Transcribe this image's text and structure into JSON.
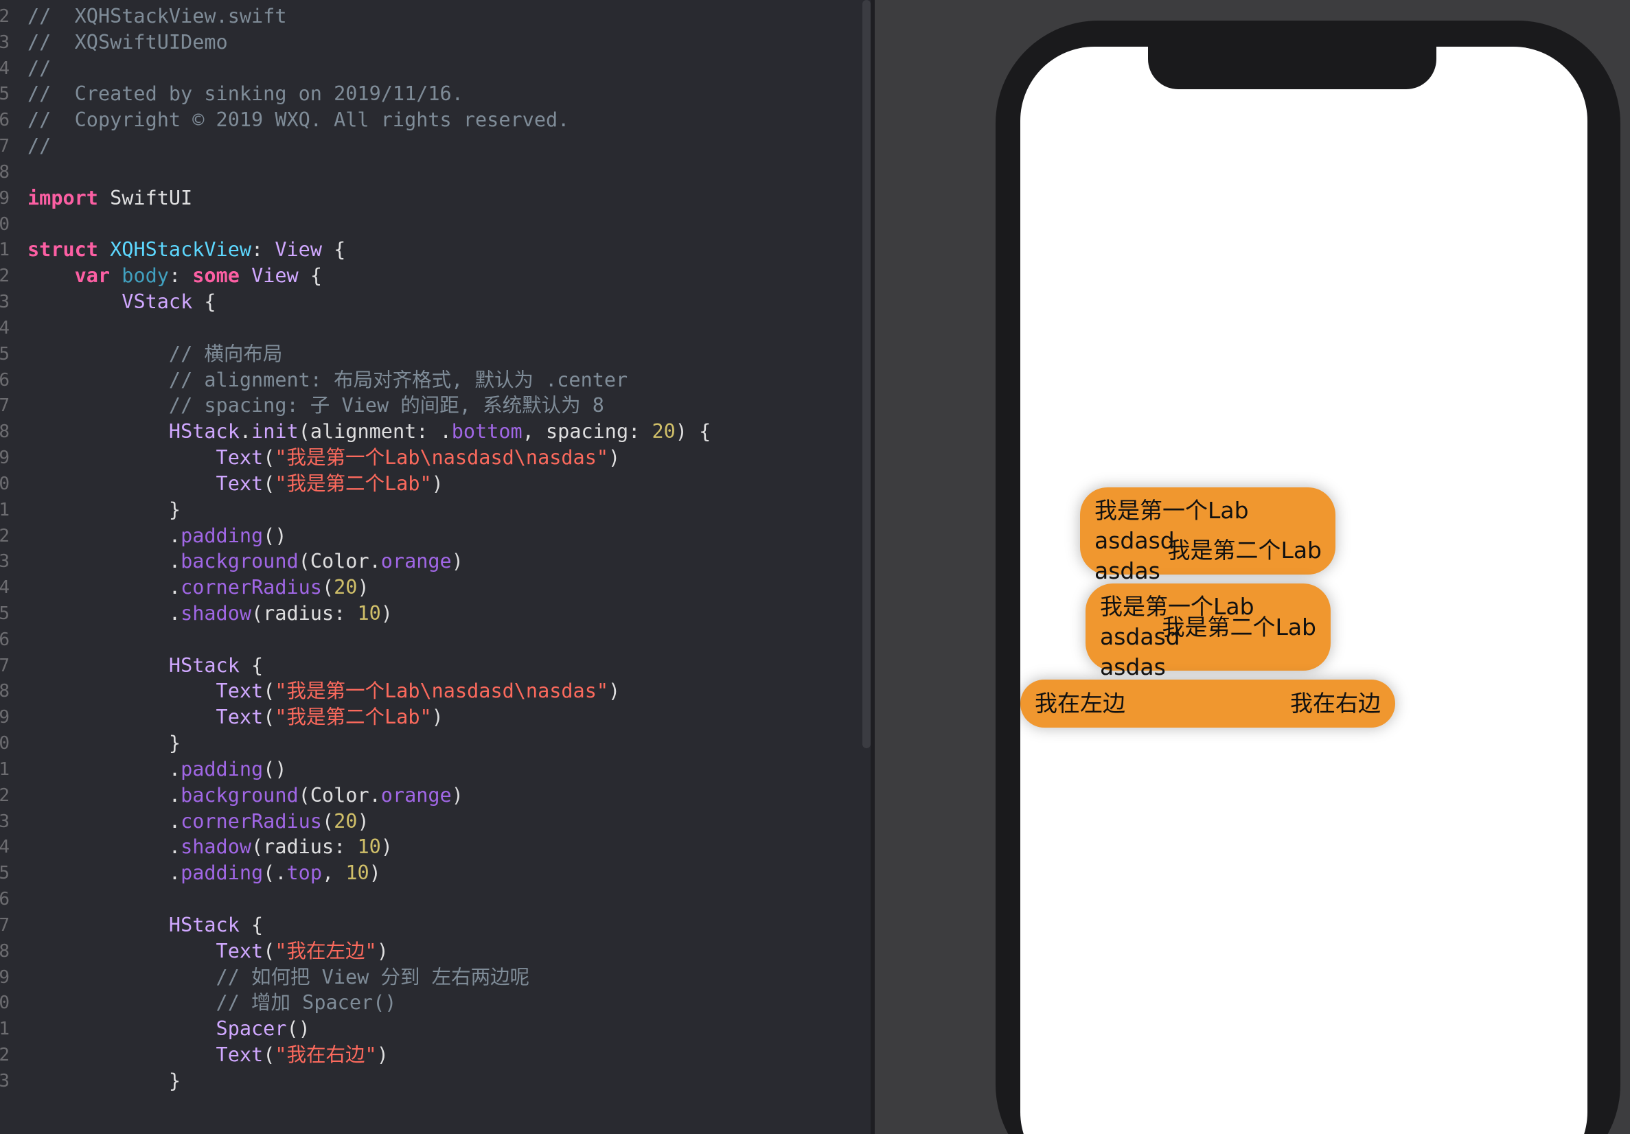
{
  "editor": {
    "lines": [
      {
        "n": "2",
        "segs": [
          {
            "c": "cm",
            "t": "//  XQHStackView.swift"
          }
        ]
      },
      {
        "n": "3",
        "segs": [
          {
            "c": "cm",
            "t": "//  XQSwiftUIDemo"
          }
        ]
      },
      {
        "n": "4",
        "segs": [
          {
            "c": "cm",
            "t": "//"
          }
        ]
      },
      {
        "n": "5",
        "segs": [
          {
            "c": "cm",
            "t": "//  Created by sinking on 2019/11/16."
          }
        ]
      },
      {
        "n": "6",
        "segs": [
          {
            "c": "cm",
            "t": "//  Copyright © 2019 WXQ. All rights reserved."
          }
        ]
      },
      {
        "n": "7",
        "segs": [
          {
            "c": "cm",
            "t": "//"
          }
        ]
      },
      {
        "n": "8",
        "segs": []
      },
      {
        "n": "9",
        "segs": [
          {
            "c": "kw",
            "t": "import"
          },
          {
            "c": "pl",
            "t": " SwiftUI"
          }
        ]
      },
      {
        "n": "0",
        "segs": []
      },
      {
        "n": "1",
        "segs": [
          {
            "c": "kw",
            "t": "struct"
          },
          {
            "c": "pl",
            "t": " "
          },
          {
            "c": "tn",
            "t": "XQHStackView"
          },
          {
            "c": "pl",
            "t": ": "
          },
          {
            "c": "ty",
            "t": "View"
          },
          {
            "c": "pl",
            "t": " {"
          }
        ]
      },
      {
        "n": "2",
        "segs": [
          {
            "c": "pl",
            "t": "    "
          },
          {
            "c": "kw",
            "t": "var"
          },
          {
            "c": "pl",
            "t": " "
          },
          {
            "c": "pv",
            "t": "body"
          },
          {
            "c": "pl",
            "t": ": "
          },
          {
            "c": "kw",
            "t": "some"
          },
          {
            "c": "pl",
            "t": " "
          },
          {
            "c": "ty",
            "t": "View"
          },
          {
            "c": "pl",
            "t": " {"
          }
        ]
      },
      {
        "n": "3",
        "segs": [
          {
            "c": "pl",
            "t": "        "
          },
          {
            "c": "ty",
            "t": "VStack"
          },
          {
            "c": "pl",
            "t": " {"
          }
        ]
      },
      {
        "n": "4",
        "segs": []
      },
      {
        "n": "5",
        "segs": [
          {
            "c": "pl",
            "t": "            "
          },
          {
            "c": "cm",
            "t": "// 横向布局"
          }
        ]
      },
      {
        "n": "6",
        "segs": [
          {
            "c": "pl",
            "t": "            "
          },
          {
            "c": "cm",
            "t": "// alignment: 布局对齐格式, 默认为 .center"
          }
        ]
      },
      {
        "n": "7",
        "segs": [
          {
            "c": "pl",
            "t": "            "
          },
          {
            "c": "cm",
            "t": "// spacing: 子 View 的间距, 系统默认为 8"
          }
        ]
      },
      {
        "n": "8",
        "segs": [
          {
            "c": "pl",
            "t": "            "
          },
          {
            "c": "ty",
            "t": "HStack"
          },
          {
            "c": "pl",
            "t": "."
          },
          {
            "c": "ty",
            "t": "init"
          },
          {
            "c": "pl",
            "t": "(alignment: ."
          },
          {
            "c": "mt",
            "t": "bottom"
          },
          {
            "c": "pl",
            "t": ", spacing: "
          },
          {
            "c": "nm",
            "t": "20"
          },
          {
            "c": "pl",
            "t": ") {"
          }
        ]
      },
      {
        "n": "9",
        "segs": [
          {
            "c": "pl",
            "t": "                "
          },
          {
            "c": "ty",
            "t": "Text"
          },
          {
            "c": "pl",
            "t": "("
          },
          {
            "c": "st",
            "t": "\"我是第一个Lab\\nasdasd\\nasdas\""
          },
          {
            "c": "pl",
            "t": ")"
          }
        ]
      },
      {
        "n": "0",
        "segs": [
          {
            "c": "pl",
            "t": "                "
          },
          {
            "c": "ty",
            "t": "Text"
          },
          {
            "c": "pl",
            "t": "("
          },
          {
            "c": "st",
            "t": "\"我是第二个Lab\""
          },
          {
            "c": "pl",
            "t": ")"
          }
        ]
      },
      {
        "n": "1",
        "segs": [
          {
            "c": "pl",
            "t": "            }"
          }
        ]
      },
      {
        "n": "2",
        "segs": [
          {
            "c": "pl",
            "t": "            ."
          },
          {
            "c": "mt",
            "t": "padding"
          },
          {
            "c": "pl",
            "t": "()"
          }
        ]
      },
      {
        "n": "3",
        "segs": [
          {
            "c": "pl",
            "t": "            ."
          },
          {
            "c": "mt",
            "t": "background"
          },
          {
            "c": "pl",
            "t": "(Color."
          },
          {
            "c": "mt",
            "t": "orange"
          },
          {
            "c": "pl",
            "t": ")"
          }
        ]
      },
      {
        "n": "4",
        "segs": [
          {
            "c": "pl",
            "t": "            ."
          },
          {
            "c": "mt",
            "t": "cornerRadius"
          },
          {
            "c": "pl",
            "t": "("
          },
          {
            "c": "nm",
            "t": "20"
          },
          {
            "c": "pl",
            "t": ")"
          }
        ]
      },
      {
        "n": "5",
        "segs": [
          {
            "c": "pl",
            "t": "            ."
          },
          {
            "c": "mt",
            "t": "shadow"
          },
          {
            "c": "pl",
            "t": "(radius: "
          },
          {
            "c": "nm",
            "t": "10"
          },
          {
            "c": "pl",
            "t": ")"
          }
        ]
      },
      {
        "n": "6",
        "segs": []
      },
      {
        "n": "7",
        "segs": [
          {
            "c": "pl",
            "t": "            "
          },
          {
            "c": "ty",
            "t": "HStack"
          },
          {
            "c": "pl",
            "t": " {"
          }
        ]
      },
      {
        "n": "8",
        "segs": [
          {
            "c": "pl",
            "t": "                "
          },
          {
            "c": "ty",
            "t": "Text"
          },
          {
            "c": "pl",
            "t": "("
          },
          {
            "c": "st",
            "t": "\"我是第一个Lab\\nasdasd\\nasdas\""
          },
          {
            "c": "pl",
            "t": ")"
          }
        ]
      },
      {
        "n": "9",
        "segs": [
          {
            "c": "pl",
            "t": "                "
          },
          {
            "c": "ty",
            "t": "Text"
          },
          {
            "c": "pl",
            "t": "("
          },
          {
            "c": "st",
            "t": "\"我是第二个Lab\""
          },
          {
            "c": "pl",
            "t": ")"
          }
        ]
      },
      {
        "n": "0",
        "segs": [
          {
            "c": "pl",
            "t": "            }"
          }
        ]
      },
      {
        "n": "1",
        "segs": [
          {
            "c": "pl",
            "t": "            ."
          },
          {
            "c": "mt",
            "t": "padding"
          },
          {
            "c": "pl",
            "t": "()"
          }
        ]
      },
      {
        "n": "2",
        "segs": [
          {
            "c": "pl",
            "t": "            ."
          },
          {
            "c": "mt",
            "t": "background"
          },
          {
            "c": "pl",
            "t": "(Color."
          },
          {
            "c": "mt",
            "t": "orange"
          },
          {
            "c": "pl",
            "t": ")"
          }
        ]
      },
      {
        "n": "3",
        "segs": [
          {
            "c": "pl",
            "t": "            ."
          },
          {
            "c": "mt",
            "t": "cornerRadius"
          },
          {
            "c": "pl",
            "t": "("
          },
          {
            "c": "nm",
            "t": "20"
          },
          {
            "c": "pl",
            "t": ")"
          }
        ]
      },
      {
        "n": "4",
        "segs": [
          {
            "c": "pl",
            "t": "            ."
          },
          {
            "c": "mt",
            "t": "shadow"
          },
          {
            "c": "pl",
            "t": "(radius: "
          },
          {
            "c": "nm",
            "t": "10"
          },
          {
            "c": "pl",
            "t": ")"
          }
        ]
      },
      {
        "n": "5",
        "segs": [
          {
            "c": "pl",
            "t": "            ."
          },
          {
            "c": "mt",
            "t": "padding"
          },
          {
            "c": "pl",
            "t": "(."
          },
          {
            "c": "mt",
            "t": "top"
          },
          {
            "c": "pl",
            "t": ", "
          },
          {
            "c": "nm",
            "t": "10"
          },
          {
            "c": "pl",
            "t": ")"
          }
        ]
      },
      {
        "n": "6",
        "segs": []
      },
      {
        "n": "7",
        "segs": [
          {
            "c": "pl",
            "t": "            "
          },
          {
            "c": "ty",
            "t": "HStack"
          },
          {
            "c": "pl",
            "t": " {"
          }
        ]
      },
      {
        "n": "8",
        "segs": [
          {
            "c": "pl",
            "t": "                "
          },
          {
            "c": "ty",
            "t": "Text"
          },
          {
            "c": "pl",
            "t": "("
          },
          {
            "c": "st",
            "t": "\"我在左边\""
          },
          {
            "c": "pl",
            "t": ")"
          }
        ]
      },
      {
        "n": "9",
        "segs": [
          {
            "c": "pl",
            "t": "                "
          },
          {
            "c": "cm",
            "t": "// 如何把 View 分到 左右两边呢"
          }
        ]
      },
      {
        "n": "0",
        "segs": [
          {
            "c": "pl",
            "t": "                "
          },
          {
            "c": "cm",
            "t": "// 增加 Spacer()"
          }
        ]
      },
      {
        "n": "1",
        "segs": [
          {
            "c": "pl",
            "t": "                "
          },
          {
            "c": "ty",
            "t": "Spacer"
          },
          {
            "c": "pl",
            "t": "()"
          }
        ]
      },
      {
        "n": "2",
        "segs": [
          {
            "c": "pl",
            "t": "                "
          },
          {
            "c": "ty",
            "t": "Text"
          },
          {
            "c": "pl",
            "t": "("
          },
          {
            "c": "st",
            "t": "\"我在右边\""
          },
          {
            "c": "pl",
            "t": ")"
          }
        ]
      },
      {
        "n": "3",
        "segs": [
          {
            "c": "pl",
            "t": "            }"
          }
        ]
      }
    ]
  },
  "preview": {
    "card1": {
      "left_text": "我是第一个Lab\nasdasd\nasdas",
      "right_text": "我是第二个Lab"
    },
    "card2": {
      "left_text": "我是第一个Lab\nasdasd\nasdas",
      "right_text": "我是第二个Lab"
    },
    "card3": {
      "left_text": "我在左边",
      "right_text": "我在右边"
    }
  },
  "colors": {
    "editor_bg": "#292a30",
    "canvas_bg": "#3d3d3f",
    "card_orange": "#f0972f",
    "keyword": "#fc5fa3",
    "string": "#fc6a5d",
    "number": "#d0bf69",
    "comment": "#7f8c98"
  }
}
